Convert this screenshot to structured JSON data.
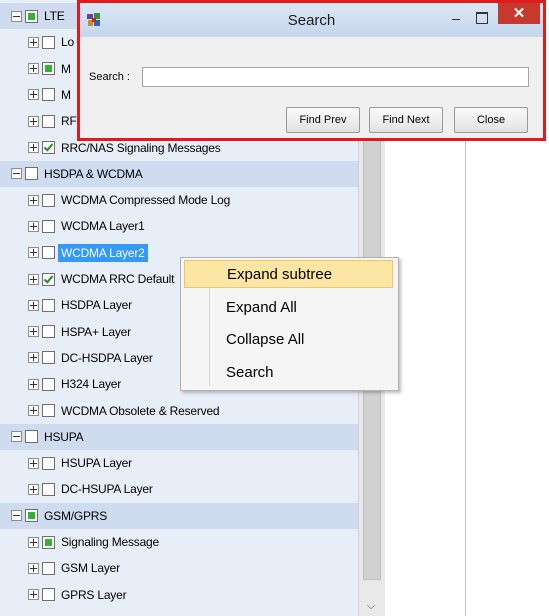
{
  "tree": {
    "rows": [
      {
        "label": "LTE",
        "level": 1,
        "expander": "minus",
        "check": "partial",
        "category": true
      },
      {
        "label": "Lo",
        "level": 2,
        "expander": "plus",
        "check": "none",
        "category": false
      },
      {
        "label": "M",
        "level": 2,
        "expander": "plus",
        "check": "partial",
        "category": false
      },
      {
        "label": "M",
        "level": 2,
        "expander": "plus",
        "check": "none",
        "category": false
      },
      {
        "label": "RF",
        "level": 2,
        "expander": "plus",
        "check": "none",
        "category": false
      },
      {
        "label": "RRC/NAS Signaling Messages",
        "level": 2,
        "expander": "plus",
        "check": "checked",
        "category": false
      },
      {
        "label": "HSDPA & WCDMA",
        "level": 1,
        "expander": "minus",
        "check": "none",
        "category": true
      },
      {
        "label": "WCDMA Compressed Mode Log",
        "level": 2,
        "expander": "plus",
        "check": "none",
        "category": false
      },
      {
        "label": "WCDMA Layer1",
        "level": 2,
        "expander": "plus",
        "check": "none",
        "category": false
      },
      {
        "label": "WCDMA Layer2",
        "level": 2,
        "expander": "plus",
        "check": "none",
        "category": false,
        "selected": true
      },
      {
        "label": "WCDMA RRC Default",
        "level": 2,
        "expander": "plus",
        "check": "checked",
        "category": false
      },
      {
        "label": "HSDPA Layer",
        "level": 2,
        "expander": "plus",
        "check": "none",
        "category": false
      },
      {
        "label": "HSPA+ Layer",
        "level": 2,
        "expander": "plus",
        "check": "none",
        "category": false
      },
      {
        "label": "DC-HSDPA Layer",
        "level": 2,
        "expander": "plus",
        "check": "none",
        "category": false
      },
      {
        "label": "H324 Layer",
        "level": 2,
        "expander": "plus",
        "check": "none",
        "category": false
      },
      {
        "label": "WCDMA Obsolete & Reserved",
        "level": 2,
        "expander": "plus",
        "check": "none",
        "category": false
      },
      {
        "label": "HSUPA",
        "level": 1,
        "expander": "minus",
        "check": "none",
        "category": true
      },
      {
        "label": "HSUPA Layer",
        "level": 2,
        "expander": "plus",
        "check": "none",
        "category": false
      },
      {
        "label": "DC-HSUPA Layer",
        "level": 2,
        "expander": "plus",
        "check": "none",
        "category": false
      },
      {
        "label": "GSM/GPRS",
        "level": 1,
        "expander": "minus",
        "check": "partial",
        "category": true
      },
      {
        "label": "Signaling Message",
        "level": 2,
        "expander": "plus",
        "check": "partial",
        "category": false
      },
      {
        "label": "GSM Layer",
        "level": 2,
        "expander": "plus",
        "check": "none",
        "category": false
      },
      {
        "label": "GPRS Layer",
        "level": 2,
        "expander": "plus",
        "check": "none",
        "category": false
      }
    ]
  },
  "context_menu": {
    "items": [
      {
        "label": "Expand subtree",
        "highlighted": true
      },
      {
        "label": "Expand All",
        "highlighted": false
      },
      {
        "label": "Collapse All",
        "highlighted": false
      },
      {
        "label": "Search",
        "highlighted": false
      }
    ]
  },
  "search_dialog": {
    "title": "Search",
    "search_label": "Search :",
    "search_value": "",
    "minimize_glyph": "–",
    "close_glyph": "✕",
    "buttons": {
      "find_prev": "Find Prev",
      "find_next": "Find Next",
      "close": "Close"
    }
  },
  "icons": {
    "app_icon": "app-icon",
    "expander_plus": "plus-box-icon",
    "expander_minus": "minus-box-icon",
    "scroll_down": "chevron-down-icon"
  },
  "colors": {
    "selection": "#3399ff",
    "menu_highlight": "#fde6a4",
    "dialog_border": "#e01b1b",
    "close_button": "#c7392c",
    "partial_check": "#33b233"
  }
}
